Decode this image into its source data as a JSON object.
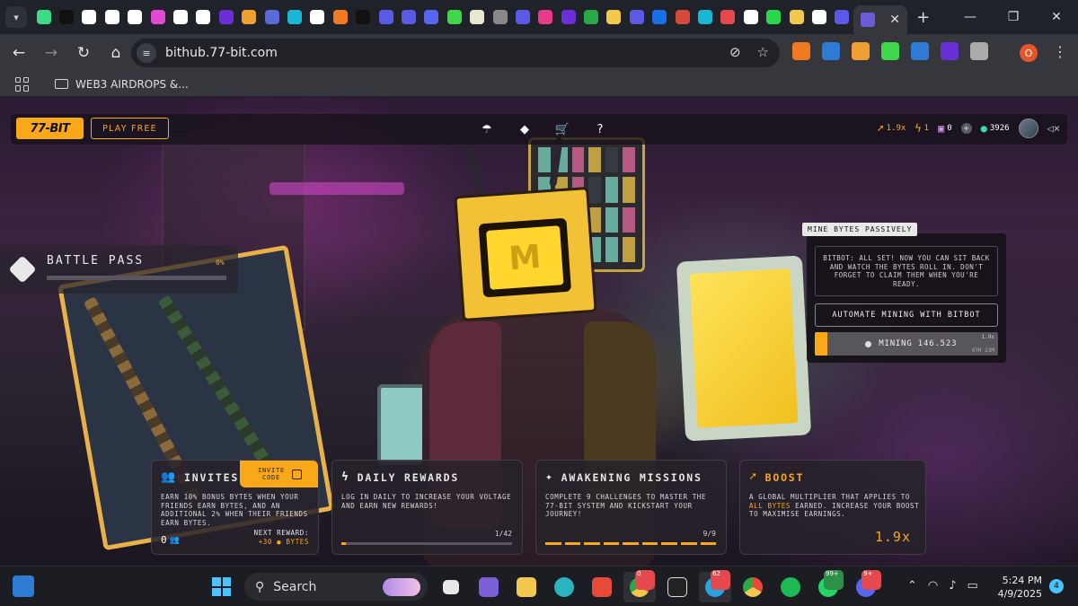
{
  "browser": {
    "active_tab_close": "✕",
    "new_tab": "+",
    "url": "bithub.77-bit.com",
    "bookmark_folder": "WEB3 AIRDROPS &...",
    "profile_initial": "O",
    "tab_favicon_colors": [
      "#3ddc84",
      "#111111",
      "#ffffff",
      "#ffffff",
      "#ffffff",
      "#e34ad1",
      "#ffffff",
      "#ffffff",
      "#6a2fd6",
      "#f0a030",
      "#5b6ad6",
      "#1ab6d6",
      "#ffffff",
      "#f07a22",
      "#111111",
      "#5a5ae6",
      "#5a5ae6",
      "#5865f2",
      "#3fd64a",
      "#e8e8d0",
      "#888888",
      "#5a5ae6",
      "#e83a8a",
      "#6a2fd6",
      "#2aa84a",
      "#f2c94c",
      "#5a5ae6",
      "#1a6ee6",
      "#d64a3a",
      "#1ab6d6",
      "#e5484d",
      "#ffffff",
      "#2ad64a",
      "#f2c94c",
      "#ffffff",
      "#5a5ae6"
    ],
    "extension_colors": [
      "#f07a22",
      "#2e7bd6",
      "#f0a030",
      "#3fd64a",
      "#2e7bd6",
      "#6a2fd6",
      "#aaaaaa"
    ]
  },
  "hud": {
    "logo": "77-BIT",
    "play_free": "PLAY FREE",
    "multiplier": "1.9x",
    "voltage": "1",
    "chips": "0",
    "bytes": "3926",
    "accent": "#f9a81a"
  },
  "battle_pass": {
    "title": "BATTLE PASS",
    "percent_label": "0%",
    "progress": 0
  },
  "mining": {
    "title": "MINE BYTES PASSIVELY",
    "message": "BITBOT: ALL SET! NOW YOU CAN SIT BACK AND WATCH THE BYTES ROLL IN. DON'T FORGET TO CLAIM THEM WHEN YOU'RE READY.",
    "button": "AUTOMATE MINING WITH BITBOT",
    "status": "MINING 146.523",
    "multiplier": "1.9x",
    "time": "07H 23M",
    "progress": 0.07
  },
  "cards": {
    "invites": {
      "title": "INVITES",
      "invite_code": "INVITE CODE",
      "body": "EARN 10% BONUS BYTES WHEN YOUR FRIENDS EARN BYTES, AND AN ADDITIONAL 2% WHEN THEIR FRIENDS EARN BYTES.",
      "count": "0",
      "next_reward_label": "NEXT REWARD:",
      "next_reward_amount": "+30",
      "next_reward_unit": "BYTES"
    },
    "daily": {
      "title": "DAILY REWARDS",
      "body": "LOG IN DAILY TO INCREASE YOUR VOLTAGE AND EARN NEW REWARDS!",
      "progress_label": "1/42",
      "progress": 0.024
    },
    "missions": {
      "title": "AWAKENING MISSIONS",
      "body": "COMPLETE 9 CHALLENGES TO MASTER THE 77-BIT SYSTEM AND KICKSTART YOUR JOURNEY!",
      "progress_label": "9/9"
    },
    "boost": {
      "title": "BOOST",
      "body_pre": "A GLOBAL MULTIPLIER THAT APPLIES TO ",
      "body_hl": "ALL BYTES",
      "body_post": " EARNED. INCREASE YOUR BOOST TO MAXIMISE EARNINGS.",
      "value": "1.9x"
    }
  },
  "taskbar": {
    "search": "Search",
    "time": "5:24 PM",
    "date": "4/9/2025",
    "notifications": "4",
    "badges": {
      "chrome": "0",
      "telegram": "62",
      "whatsapp": "99+",
      "discord": "9+"
    }
  }
}
